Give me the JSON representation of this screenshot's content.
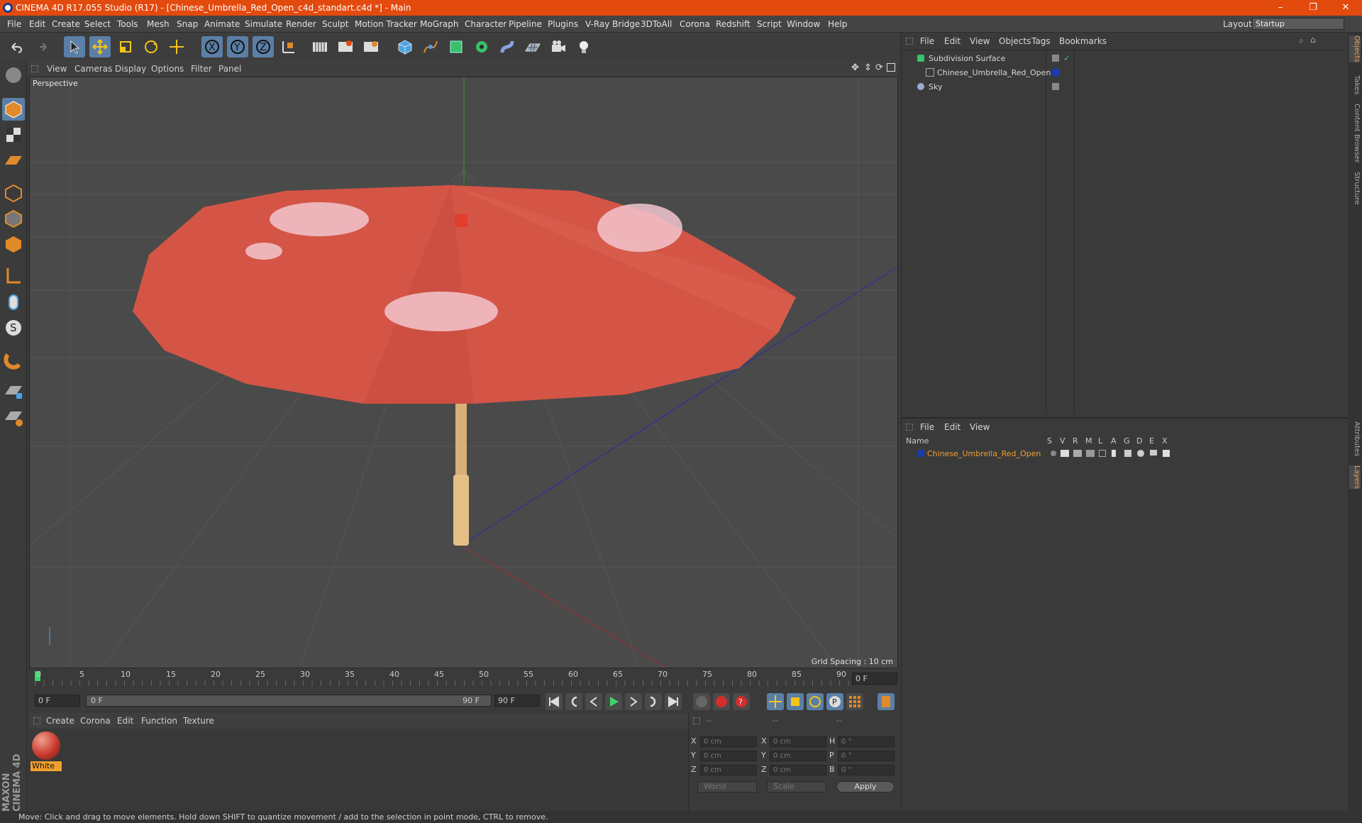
{
  "window": {
    "title": "CINEMA 4D R17.055 Studio (R17) - [Chinese_Umbrella_Red_Open_c4d_standart.c4d *] - Main",
    "minimize": "–",
    "maximize": "❐",
    "close": "✕"
  },
  "menu": [
    "File",
    "Edit",
    "Create",
    "Select",
    "Tools",
    "Mesh",
    "Snap",
    "Animate",
    "Simulate",
    "Render",
    "Sculpt",
    "Motion Tracker",
    "MoGraph",
    "Character",
    "Pipeline",
    "Plugins",
    "V-Ray Bridge",
    "3DToAll",
    "Corona",
    "Redshift",
    "Script",
    "Window",
    "Help"
  ],
  "layout": {
    "label": "Layout:",
    "value": "Startup"
  },
  "viewport": {
    "menu": [
      "View",
      "Cameras",
      "Display",
      "Options",
      "Filter",
      "Panel"
    ],
    "label": "Perspective",
    "grid_spacing": "Grid Spacing : 10 cm"
  },
  "timeline": {
    "ticks": [
      "0",
      "5",
      "10",
      "15",
      "20",
      "25",
      "30",
      "35",
      "40",
      "45",
      "50",
      "55",
      "60",
      "65",
      "70",
      "75",
      "80",
      "85",
      "90"
    ],
    "end_field": "0 F"
  },
  "transport": {
    "start": "0 F",
    "range_start": "0 F",
    "range_end": "90 F",
    "end": "90 F"
  },
  "material": {
    "menu": [
      "Create",
      "Corona",
      "Edit",
      "Function",
      "Texture"
    ],
    "items": [
      {
        "name": "White"
      }
    ]
  },
  "coords": {
    "headers": [
      "--",
      "--",
      "--"
    ],
    "rows": [
      {
        "a": "X",
        "av": "0 cm",
        "b": "X",
        "bv": "0 cm",
        "c": "H",
        "cv": "0 °"
      },
      {
        "a": "Y",
        "av": "0 cm",
        "b": "Y",
        "bv": "0 cm",
        "c": "P",
        "cv": "0 °"
      },
      {
        "a": "Z",
        "av": "0 cm",
        "b": "Z",
        "bv": "0 cm",
        "c": "B",
        "cv": "0 °"
      }
    ],
    "world": "World",
    "scale": "Scale",
    "apply": "Apply"
  },
  "objects": {
    "menu": [
      "File",
      "Edit",
      "View",
      "Objects",
      "Tags",
      "Bookmarks"
    ],
    "items": [
      {
        "name": "Subdivision Surface"
      },
      {
        "name": "Chinese_Umbrella_Red_Open"
      },
      {
        "name": "Sky"
      }
    ]
  },
  "layers": {
    "menu": [
      "File",
      "Edit",
      "View"
    ],
    "header": {
      "name": "Name",
      "cols": [
        "S",
        "V",
        "R",
        "M",
        "L",
        "A",
        "G",
        "D",
        "E",
        "X"
      ]
    },
    "items": [
      {
        "name": "Chinese_Umbrella_Red_Open"
      }
    ]
  },
  "right_tabs": [
    "Objects",
    "Takes",
    "Content Browser",
    "Structure",
    "Attributes",
    "Layers"
  ],
  "status": "Move: Click and drag to move elements. Hold down SHIFT to quantize movement / add to the selection in point mode, CTRL to remove.",
  "brand": "MAXON CINEMA 4D",
  "colors": {
    "title": "#e34a0e",
    "accent": "#5b7fa6",
    "umbrella": "#d8574a",
    "layer": "#f0a030"
  }
}
